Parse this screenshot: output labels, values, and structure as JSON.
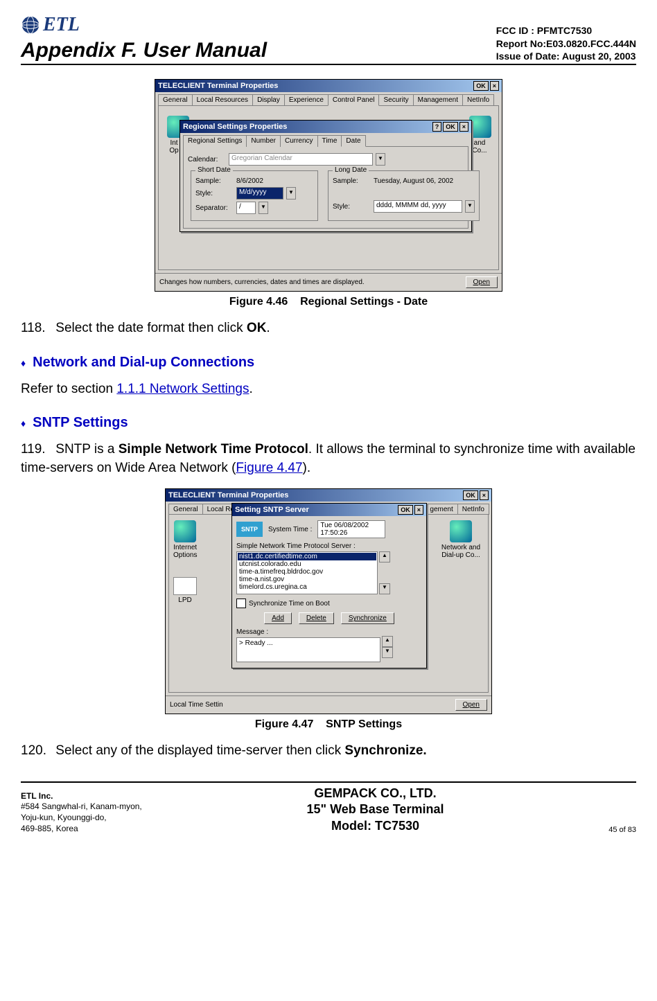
{
  "header": {
    "logo_text": "ETL",
    "appendix": "Appendix F. User Manual",
    "fcc": "FCC ID : PFMTC7530",
    "report": "Report No:E03.0820.FCC.444N",
    "issue": "Issue of Date:  August 20, 2003"
  },
  "fig1": {
    "window_title": "TELECLIENT Terminal Properties",
    "ok": "OK",
    "outer_tabs": [
      "General",
      "Local Resources",
      "Display",
      "Experience",
      "Control Panel",
      "Security",
      "Management",
      "NetInfo"
    ],
    "outer_active": "Control Panel",
    "icons_left": "Int\nOp",
    "icons_right": "and\nCo...",
    "inner_title": "Regional Settings Properties",
    "inner_tabs": [
      "Regional Settings",
      "Number",
      "Currency",
      "Time",
      "Date"
    ],
    "inner_active": "Date",
    "calendar_label": "Calendar:",
    "calendar_value": "Gregorian Calendar",
    "short_legend": "Short Date",
    "long_legend": "Long Date",
    "sample_label": "Sample:",
    "style_label": "Style:",
    "separator_label": "Separator:",
    "short_sample": "8/6/2002",
    "short_style": "M/d/yyyy",
    "short_sep": "/",
    "long_sample": "Tuesday, August 06, 2002",
    "long_style": "dddd, MMMM dd, yyyy",
    "status": "Changes how numbers, currencies, dates and times are displayed.",
    "open": "Open",
    "caption_num": "Figure 4.46",
    "caption_text": "Regional Settings - Date"
  },
  "step118": {
    "num": "118.",
    "text_a": "Select the date format then click ",
    "bold": "OK",
    "text_b": "."
  },
  "sec_network": {
    "title": "Network and Dial-up Connections",
    "text_a": "Refer to section ",
    "link": "1.1.1 Network Settings",
    "text_b": "."
  },
  "sec_sntp": {
    "title": "SNTP Settings"
  },
  "step119": {
    "num": "119.",
    "text_a": "SNTP is a ",
    "bold": "Simple Network Time Protocol",
    "text_b": ".  It allows the terminal to synchronize time with available time-servers on Wide Area Network (",
    "link": "Figure 4.47",
    "text_c": ")."
  },
  "fig2": {
    "window_title": "TELECLIENT Terminal Properties",
    "ok": "OK",
    "outer_tabs_left": [
      "General",
      "Local Res"
    ],
    "outer_tabs_right": [
      "gement",
      "NetInfo"
    ],
    "inner_title": "Setting SNTP Server",
    "sntp_label": "SNTP",
    "systime_label": "System Time :",
    "systime_value": "Tue 06/08/2002\n17:50:26",
    "server_label": "Simple Network Time Protocol Server :",
    "servers": [
      "nist1.dc.certifiedtime.com",
      "utcnist.colorado.edu",
      "time-a.timefreq.bldrdoc.gov",
      "time-a.nist.gov",
      "timelord.cs.uregina.ca"
    ],
    "sync_boot": "Synchronize Time on Boot",
    "btn_add": "Add",
    "btn_delete": "Delete",
    "btn_sync": "Synchronize",
    "msg_label": "Message :",
    "msg_value": "> Ready ...",
    "left_icon1": "Internet\nOptions",
    "left_icon2": "LPD",
    "right_icon": "Network and\nDial-up Co...",
    "bottom_left": "Local Time Settin",
    "open": "Open",
    "caption_num": "Figure 4.47",
    "caption_text": "SNTP Settings"
  },
  "step120": {
    "num": "120.",
    "text_a": "Select any of the displayed time-server then click ",
    "bold": "Synchronize."
  },
  "footer": {
    "l1": "ETL Inc.",
    "l2": "#584 Sangwhal-ri, Kanam-myon,",
    "l3": "Yoju-kun, Kyounggi-do,",
    "l4": "469-885, Korea",
    "c1": "GEMPACK CO., LTD.",
    "c2": "15\" Web Base Terminal",
    "c3": "Model: TC7530",
    "r": "45 of 83"
  }
}
